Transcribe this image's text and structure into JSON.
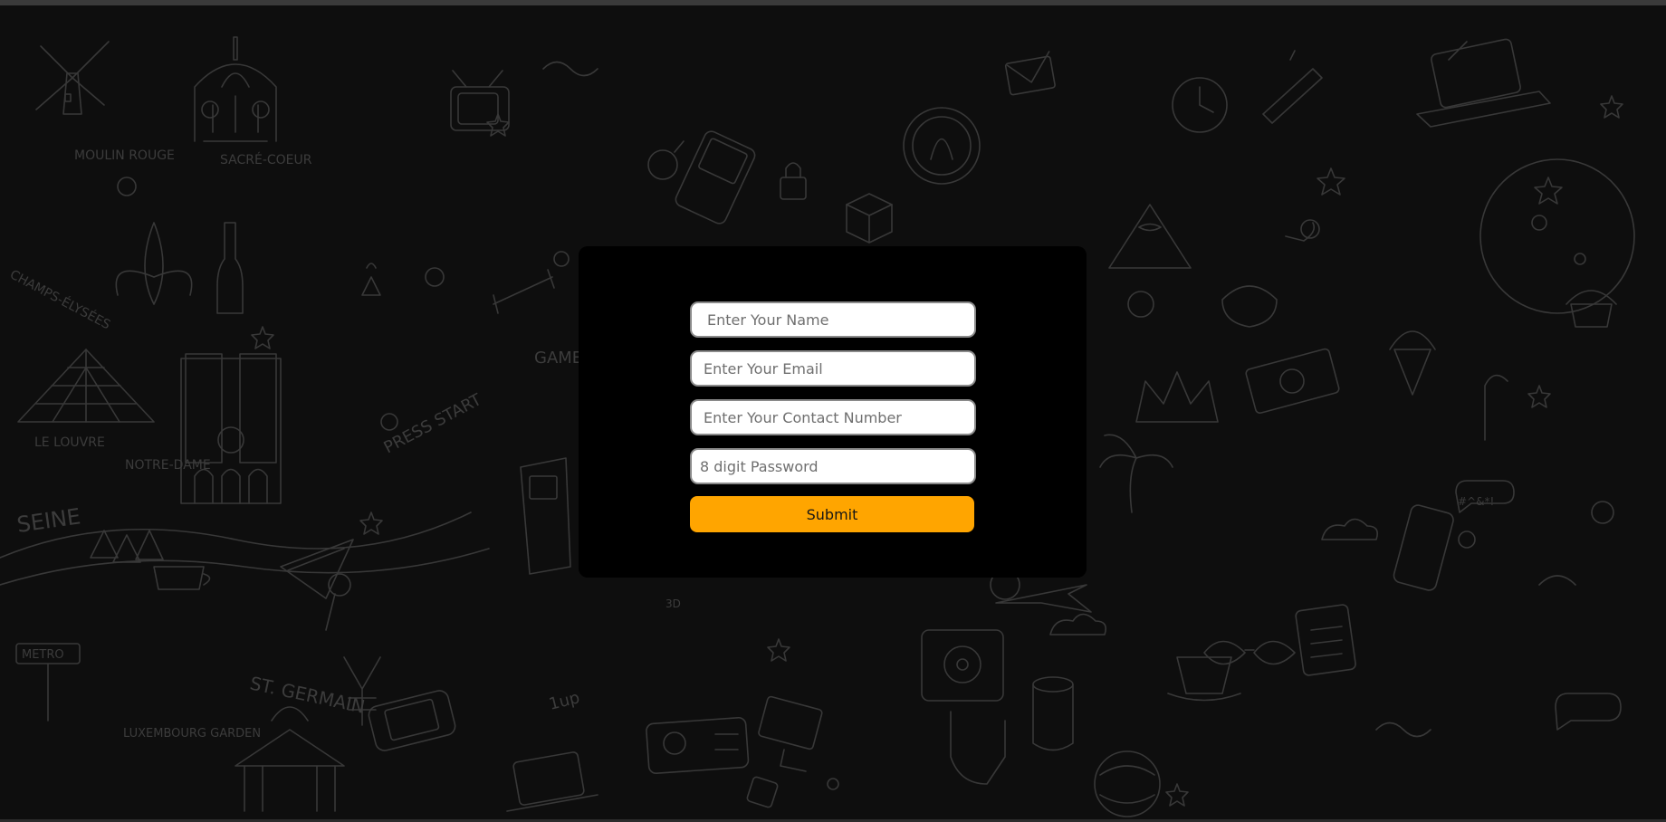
{
  "form": {
    "name_placeholder": "Enter Your Name",
    "email_placeholder": "Enter Your Email",
    "contact_placeholder": "Enter Your Contact Number",
    "password_placeholder": "8 digit Password",
    "submit_label": "Submit"
  },
  "background": {
    "doodle_labels": [
      "MOULIN ROUGE",
      "SACRÉ-COEUR",
      "CHAMPS-ÉLYSÉES",
      "LE LOUVRE",
      "NOTRE-DAME",
      "SEINE",
      "PRESS START",
      "GAME OVER",
      "METRO",
      "ST. GERMAIN",
      "LUXEMBOURG GARDEN",
      "#^&*!",
      "3D",
      "1up"
    ]
  },
  "colors": {
    "page_background": "#0e0e0e",
    "doodle_stroke": "#3a3a3a",
    "panel_background": "#000000",
    "accent_button": "#ffa500",
    "field_border": "#8a8a8a"
  }
}
